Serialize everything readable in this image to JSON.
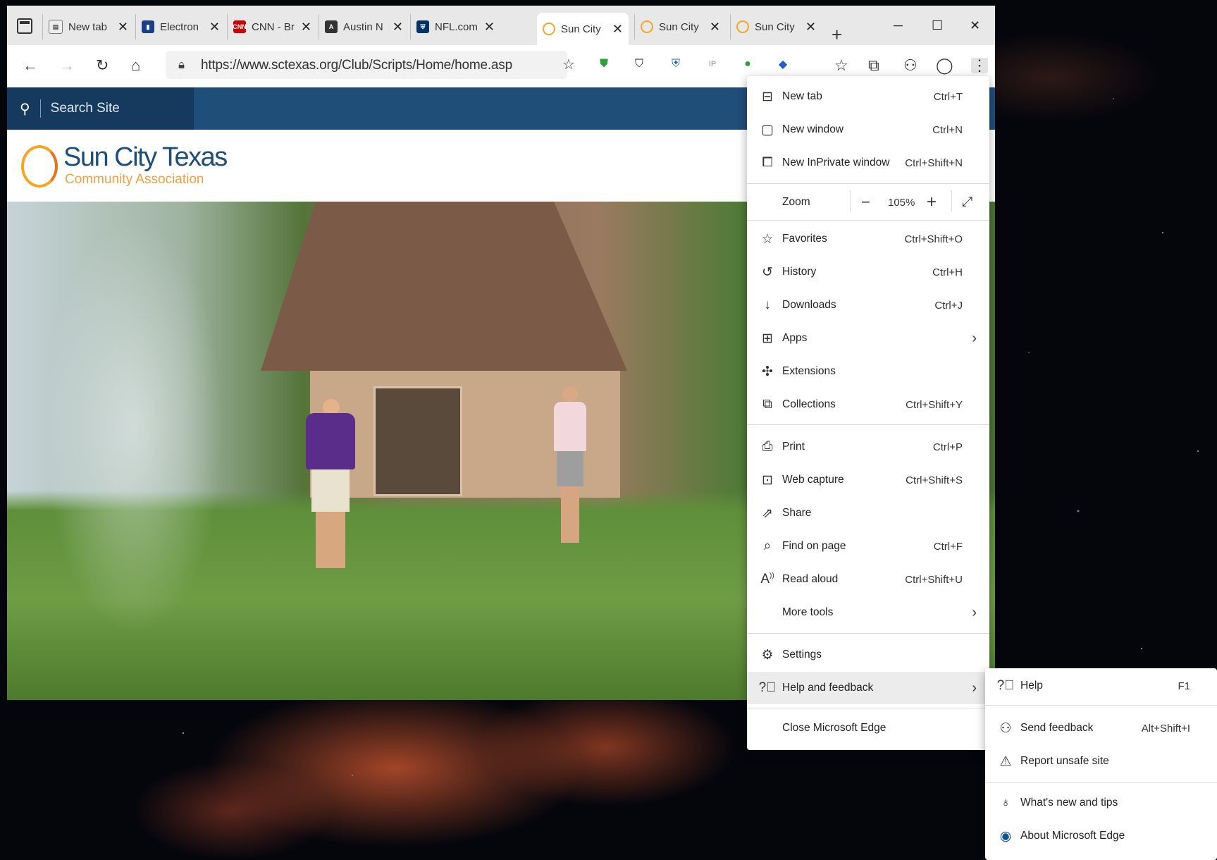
{
  "browser": {
    "tabs": [
      {
        "title": "New tab",
        "favicon": "newtab",
        "color": "#555555",
        "active": false
      },
      {
        "title": "Electron",
        "favicon": "electron",
        "color": "#1a3f8a",
        "active": false
      },
      {
        "title": "CNN - Br",
        "favicon": "CNN",
        "color": "#cc0000",
        "active": false
      },
      {
        "title": "Austin N",
        "favicon": "austin",
        "color": "#333333",
        "active": false
      },
      {
        "title": "NFL.com",
        "favicon": "nfl",
        "color": "#013369",
        "active": false
      },
      {
        "title": "Sun City",
        "favicon": "suncity",
        "color": "#f5a623",
        "active": true
      },
      {
        "title": "Sun City",
        "favicon": "suncity",
        "color": "#f5a623",
        "active": false
      },
      {
        "title": "Sun City",
        "favicon": "suncity",
        "color": "#f5a623",
        "active": false
      }
    ],
    "url": "https://www.sctexas.org/Club/Scripts/Home/home.asp"
  },
  "site": {
    "search_placeholder": "Search Site",
    "logo_name": "Sun City Texas",
    "logo_sub": "Community Association"
  },
  "menu": {
    "new_tab": {
      "label": "New tab",
      "shortcut": "Ctrl+T"
    },
    "new_window": {
      "label": "New window",
      "shortcut": "Ctrl+N"
    },
    "new_inprivate": {
      "label": "New InPrivate window",
      "shortcut": "Ctrl+Shift+N"
    },
    "zoom": {
      "label": "Zoom",
      "value": "105%"
    },
    "favorites": {
      "label": "Favorites",
      "shortcut": "Ctrl+Shift+O"
    },
    "history": {
      "label": "History",
      "shortcut": "Ctrl+H"
    },
    "downloads": {
      "label": "Downloads",
      "shortcut": "Ctrl+J"
    },
    "apps": {
      "label": "Apps"
    },
    "extensions": {
      "label": "Extensions"
    },
    "collections": {
      "label": "Collections",
      "shortcut": "Ctrl+Shift+Y"
    },
    "print": {
      "label": "Print",
      "shortcut": "Ctrl+P"
    },
    "web_capture": {
      "label": "Web capture",
      "shortcut": "Ctrl+Shift+S"
    },
    "share": {
      "label": "Share"
    },
    "find": {
      "label": "Find on page",
      "shortcut": "Ctrl+F"
    },
    "read_aloud": {
      "label": "Read aloud",
      "shortcut": "Ctrl+Shift+U"
    },
    "more_tools": {
      "label": "More tools"
    },
    "settings": {
      "label": "Settings"
    },
    "help_feedback": {
      "label": "Help and feedback"
    },
    "close_edge": {
      "label": "Close Microsoft Edge"
    }
  },
  "submenu": {
    "help": {
      "label": "Help",
      "shortcut": "F1"
    },
    "send_feedback": {
      "label": "Send feedback",
      "shortcut": "Alt+Shift+I"
    },
    "report_unsafe": {
      "label": "Report unsafe site"
    },
    "whats_new": {
      "label": "What's new and tips"
    },
    "about": {
      "label": "About Microsoft Edge"
    }
  }
}
